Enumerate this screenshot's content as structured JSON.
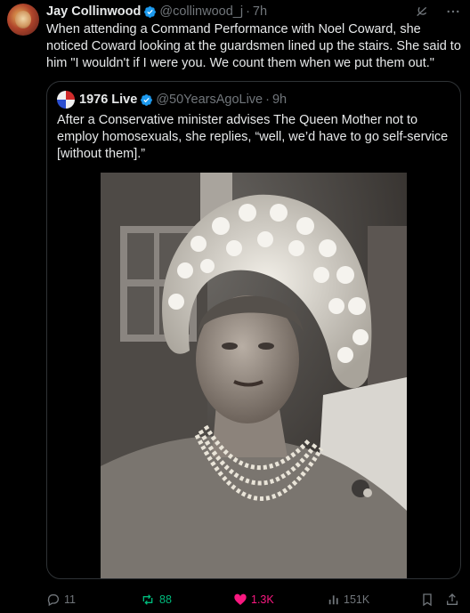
{
  "post": {
    "author_name": "Jay Collinwood",
    "author_handle": "@collinwood_j",
    "separator": "·",
    "time": "7h",
    "text": "When attending a Command Performance with Noel Coward, she noticed Coward looking at the guardsmen lined up the stairs. She said to him \"I wouldn't if I were you. We count them when we put them out.\""
  },
  "quoted": {
    "author_name": "1976 Live",
    "author_handle": "@50YearsAgoLive",
    "separator": "·",
    "time": "9h",
    "text": "After a Conservative minister advises The Queen Mother not to employ homosexuals, she replies, “well, we’d have to go self-service [without them].”"
  },
  "actions": {
    "replies": "11",
    "reposts": "88",
    "likes": "1.3K",
    "views": "151K"
  },
  "colors": {
    "background": "#000000",
    "text": "#e7e9ea",
    "muted": "#71767b",
    "verified": "#1d9bf0",
    "repost_active": "#00ba7c",
    "like_active": "#f91880",
    "border": "#2f3336"
  },
  "icons": [
    "verified-badge-icon",
    "grok-icon",
    "more-icon",
    "reply-icon",
    "repost-icon",
    "like-icon",
    "views-icon",
    "bookmark-icon",
    "share-icon"
  ]
}
